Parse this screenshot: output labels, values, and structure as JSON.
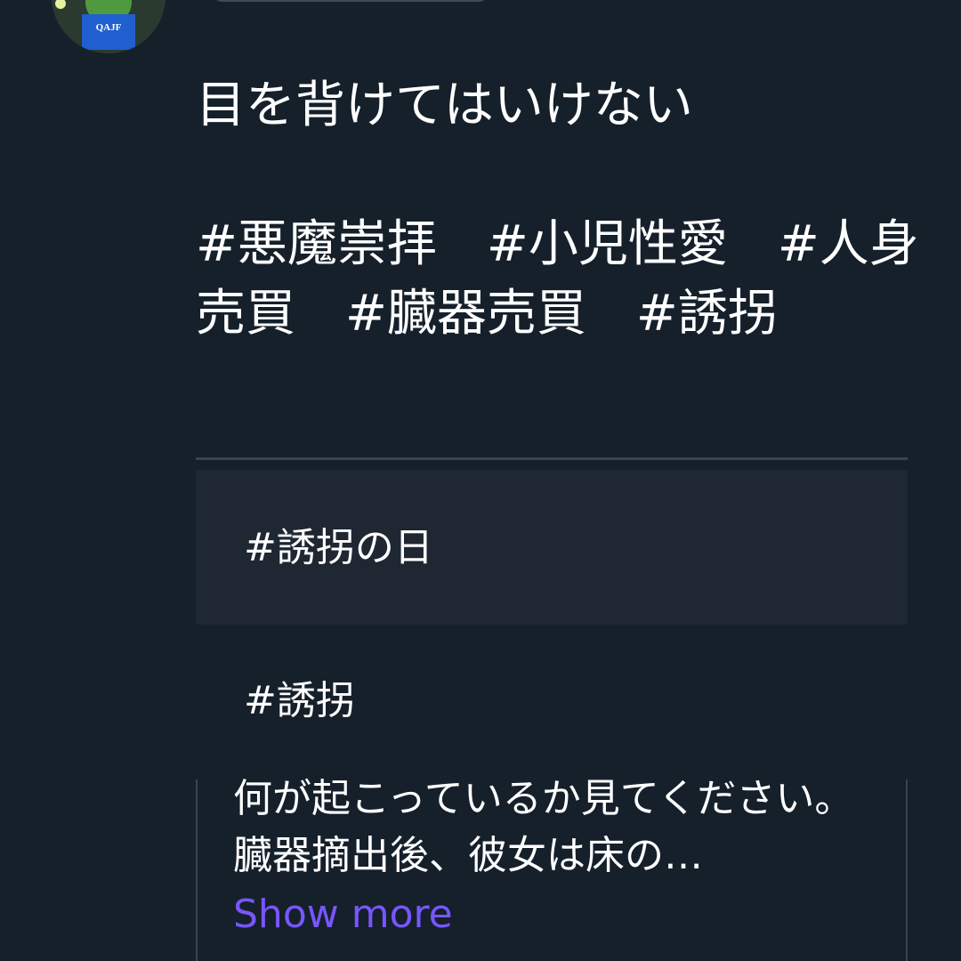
{
  "avatar": {
    "badge_text": "QAJF"
  },
  "post": {
    "text": "目を背けてはいけない\n\n#悪魔崇拝　#小児性愛　#人身売買　#臓器売買　#誘拐"
  },
  "trends": [
    {
      "label": "#誘拐の日"
    },
    {
      "label": "#誘拐"
    }
  ],
  "quote": {
    "text": "何が起こっているか見てください。臓器摘出後、彼女は床の…",
    "show_more_label": "Show more"
  },
  "colors": {
    "background": "#15202b",
    "trend_band": "#1e2732",
    "divider": "#38444d",
    "link": "#7856ff",
    "text": "#ffffff"
  }
}
